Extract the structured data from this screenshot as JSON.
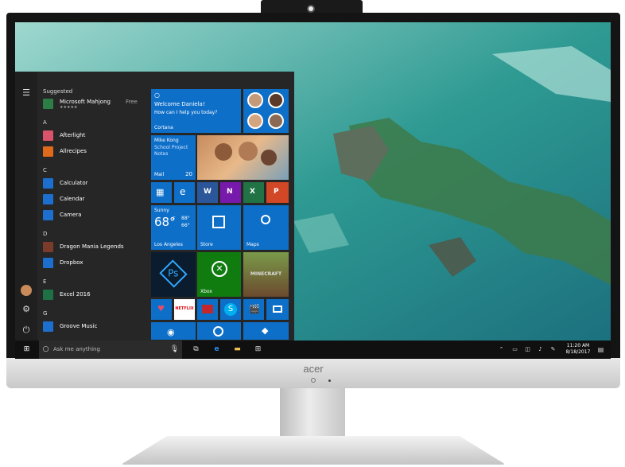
{
  "brand": "acer",
  "start_menu": {
    "suggested_header": "Suggested",
    "suggested_app": {
      "name": "Microsoft Mahjong",
      "badge": "Free",
      "rating": "★★★★★"
    },
    "sections": [
      {
        "letter": "A",
        "apps": [
          "Afterlight",
          "Allrecipes"
        ]
      },
      {
        "letter": "C",
        "apps": [
          "Calculator",
          "Calendar",
          "Camera"
        ]
      },
      {
        "letter": "D",
        "apps": [
          "Dragon Mania Legends",
          "Dropbox"
        ]
      },
      {
        "letter": "E",
        "apps": [
          "Excel 2016"
        ]
      },
      {
        "letter": "G",
        "apps": [
          "Groove Music"
        ]
      }
    ],
    "cortana": {
      "greeting": "Welcome Daniela!",
      "prompt": "How can I help you today?",
      "label": "Cortana"
    },
    "mail": {
      "sender": "Mike Kong",
      "subject": "School Project",
      "preview": "Notes",
      "label": "Mail",
      "count": "20"
    },
    "weather": {
      "condition": "Sunny",
      "temp": "68°",
      "high": "88°",
      "low": "66°",
      "unit": "F",
      "city": "Los Angeles"
    },
    "store_label": "Store",
    "maps_label": "Maps",
    "xbox_label": "Xbox",
    "netflix_label": "NETFLIX",
    "minecraft_label": "MINECRAFT"
  },
  "taskbar": {
    "search_placeholder": "Ask me anything",
    "time": "11:20 AM",
    "date": "8/18/2017"
  },
  "colors": {
    "tile_blue": "#0e6fc9",
    "start_bg": "#262626",
    "taskbar_bg": "#101010"
  }
}
